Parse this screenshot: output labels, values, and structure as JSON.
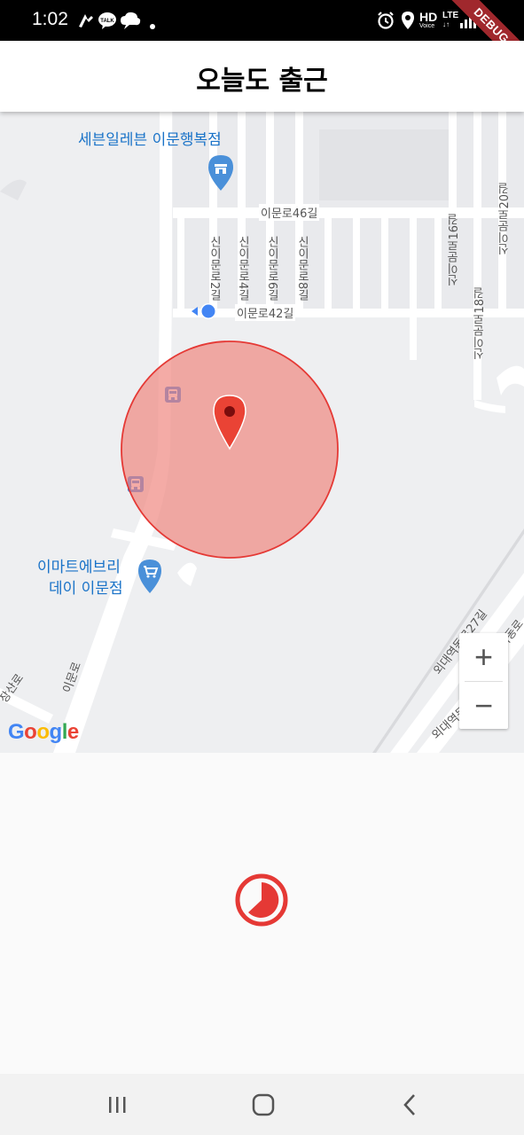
{
  "status_bar": {
    "time": "1:02",
    "left_icons": [
      "signature-icon",
      "talk-icon",
      "cloud-chat-icon",
      "dot-icon"
    ],
    "right_icons": [
      "alarm-icon",
      "location-icon",
      "hd-voice-icon",
      "lte-icon",
      "signal-icon",
      "battery-icon"
    ],
    "hd_label": "HD",
    "voice_label": "Voice",
    "lte_label": "LTE",
    "debug_label": "DEBUG"
  },
  "app_bar": {
    "title": "오늘도 출근"
  },
  "map": {
    "poi": [
      {
        "name": "세븐일레븐 이문행복점",
        "icon": "store-pin-icon"
      },
      {
        "name_line1": "이마트에브리",
        "name_line2": "데이 이문점",
        "icon": "shopping-cart-pin-icon"
      }
    ],
    "roads": {
      "imun46": "이문로46길",
      "imun42": "이문로42길",
      "sinimun2": "신이문로2길",
      "sinimun4": "신이문로4길",
      "sinimun6": "신이문로6길",
      "sinimun8": "신이문로8길",
      "sinimun16": "신이문로16길",
      "sinimun18": "신이문로18길",
      "sinimun20": "신이문로20길",
      "imunro": "이문로",
      "jangsanro": "장산로",
      "oedae27": "외대역동로27길",
      "oedaedong": "외대역동로",
      "oedae6": "외대역동로6길"
    },
    "geofence_color": "#f4a19c",
    "geofence_stroke": "#e53935",
    "marker_color": "#ea4335",
    "my_location_color": "#4285f4",
    "zoom_in_label": "+",
    "zoom_out_label": "−",
    "attribution": [
      "G",
      "o",
      "o",
      "g",
      "l",
      "e"
    ]
  },
  "content": {
    "spinner_color": "#e53935"
  },
  "nav_bar": {
    "recents_icon": "recents-icon",
    "home_icon": "home-icon",
    "back_icon": "back-icon"
  }
}
